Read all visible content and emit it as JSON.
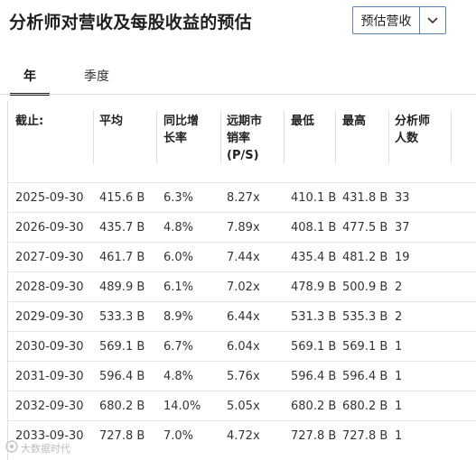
{
  "header": {
    "title": "分析师对营收及每股收益的预估",
    "selector": {
      "selected": "预估营收",
      "arrow_icon": "chevron-down-icon"
    }
  },
  "tabs": [
    {
      "label": "年",
      "active": true
    },
    {
      "label": "季度",
      "active": false
    }
  ],
  "table": {
    "columns": [
      "截止:",
      "平均",
      "同比增\n长率",
      "远期市\n销率\n(P/S)",
      "最低",
      "最高",
      "分析师\n人数"
    ],
    "rows": [
      [
        "2025-09-30",
        "415.6 B",
        "6.3%",
        "8.27x",
        "410.1 B",
        "431.8 B",
        "33"
      ],
      [
        "2026-09-30",
        "435.7 B",
        "4.8%",
        "7.89x",
        "408.1 B",
        "477.5 B",
        "37"
      ],
      [
        "2027-09-30",
        "461.7 B",
        "6.0%",
        "7.44x",
        "435.4 B",
        "481.2 B",
        "19"
      ],
      [
        "2028-09-30",
        "489.9 B",
        "6.1%",
        "7.02x",
        "478.9 B",
        "500.9 B",
        "2"
      ],
      [
        "2029-09-30",
        "533.3 B",
        "8.9%",
        "6.44x",
        "531.3 B",
        "535.3 B",
        "2"
      ],
      [
        "2030-09-30",
        "569.1 B",
        "6.7%",
        "6.04x",
        "569.1 B",
        "569.1 B",
        "1"
      ],
      [
        "2031-09-30",
        "596.4 B",
        "4.8%",
        "5.76x",
        "596.4 B",
        "596.4 B",
        "1"
      ],
      [
        "2032-09-30",
        "680.2 B",
        "14.0%",
        "5.05x",
        "680.2 B",
        "680.2 B",
        "1"
      ],
      [
        "2033-09-30",
        "727.8 B",
        "7.0%",
        "4.72x",
        "727.8 B",
        "727.8 B",
        "1"
      ]
    ]
  },
  "watermark": {
    "text": "大数据时代",
    "icon": "watermark-logo-icon"
  }
}
